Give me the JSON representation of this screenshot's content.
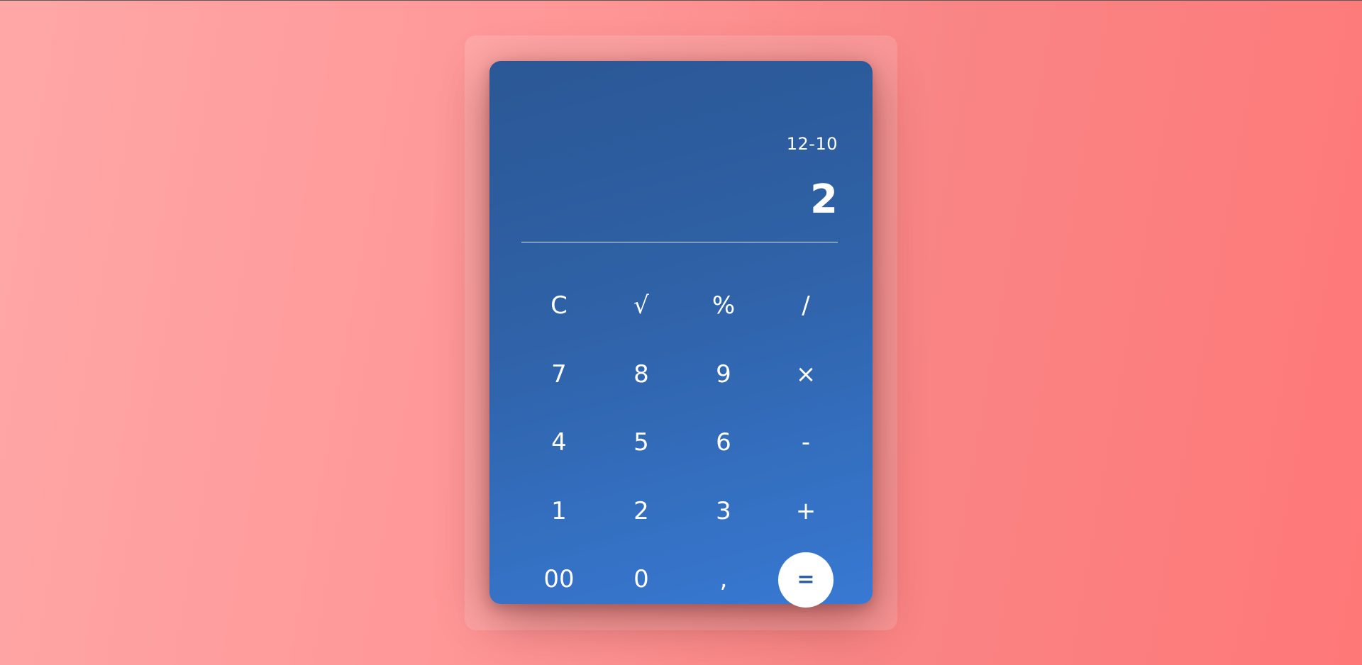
{
  "display": {
    "expression": "12-10",
    "result": "2"
  },
  "keypad": {
    "rows": [
      [
        {
          "name": "clear-key",
          "label": "C"
        },
        {
          "name": "sqrt-key",
          "label": "√"
        },
        {
          "name": "percent-key",
          "label": "%"
        },
        {
          "name": "divide-key",
          "label": "/"
        }
      ],
      [
        {
          "name": "digit-7-key",
          "label": "7"
        },
        {
          "name": "digit-8-key",
          "label": "8"
        },
        {
          "name": "digit-9-key",
          "label": "9"
        },
        {
          "name": "multiply-key",
          "label": "×"
        }
      ],
      [
        {
          "name": "digit-4-key",
          "label": "4"
        },
        {
          "name": "digit-5-key",
          "label": "5"
        },
        {
          "name": "digit-6-key",
          "label": "6"
        },
        {
          "name": "subtract-key",
          "label": "-"
        }
      ],
      [
        {
          "name": "digit-1-key",
          "label": "1"
        },
        {
          "name": "digit-2-key",
          "label": "2"
        },
        {
          "name": "digit-3-key",
          "label": "3"
        },
        {
          "name": "add-key",
          "label": "+"
        }
      ],
      [
        {
          "name": "double-zero-key",
          "label": "00"
        },
        {
          "name": "digit-0-key",
          "label": "0"
        },
        {
          "name": "decimal-comma-key",
          "label": ","
        },
        {
          "name": "equals-key",
          "label": "="
        }
      ]
    ]
  },
  "colors": {
    "background_start": "#ffa7a7",
    "background_end": "#ff7878",
    "panel_top": "#2b5795",
    "panel_bottom": "#3879d3",
    "equals_button": "#ffffff",
    "equals_text": "#2d5fa8"
  }
}
